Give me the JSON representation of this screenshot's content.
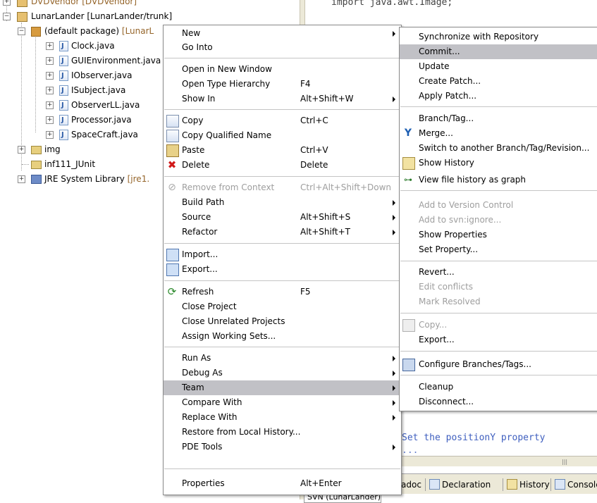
{
  "editor": {
    "code_top": "import java.awt.Image;",
    "comment_line": "Set the positionY property",
    "comment_line2": "...",
    "svn_tab": "SVN (LunarLander)"
  },
  "tree": {
    "top_row": "DVDVendor [DVDVendor]",
    "project": "LunarLander [LunarLander/trunk]",
    "package_label": "(default package)",
    "package_decor": "[LunarL",
    "files": [
      "Clock.java",
      "GUIEnvironment.java",
      "IObserver.java",
      "ISubject.java",
      "ObserverLL.java",
      "Processor.java",
      "SpaceCraft.java"
    ],
    "img": "img",
    "junit": "inf111_JUnit",
    "jre_label": "JRE System Library",
    "jre_decor": "[jre1."
  },
  "context_menu": {
    "items": [
      {
        "label": "New",
        "accel": "",
        "submenu": true
      },
      {
        "label": "Go Into",
        "accel": ""
      },
      {
        "label": "Open in New Window",
        "accel": ""
      },
      {
        "label": "Open Type Hierarchy",
        "accel": "F4"
      },
      {
        "label": "Show In",
        "accel": "Alt+Shift+W",
        "submenu": true
      },
      {
        "label": "Copy",
        "accel": "Ctrl+C",
        "icon": "copy-icon"
      },
      {
        "label": "Copy Qualified Name",
        "accel": "",
        "icon": "copy-icon"
      },
      {
        "label": "Paste",
        "accel": "Ctrl+V",
        "icon": "paste-icon"
      },
      {
        "label": "Delete",
        "accel": "Delete",
        "icon": "delete-icon"
      },
      {
        "label": "Remove from Context",
        "accel": "Ctrl+Alt+Shift+Down",
        "icon": "remove-icon",
        "disabled": true
      },
      {
        "label": "Build Path",
        "accel": "",
        "submenu": true
      },
      {
        "label": "Source",
        "accel": "Alt+Shift+S",
        "submenu": true
      },
      {
        "label": "Refactor",
        "accel": "Alt+Shift+T",
        "submenu": true
      },
      {
        "label": "Import...",
        "accel": "",
        "icon": "import-icon"
      },
      {
        "label": "Export...",
        "accel": "",
        "icon": "export-icon"
      },
      {
        "label": "Refresh",
        "accel": "F5",
        "icon": "refresh-icon"
      },
      {
        "label": "Close Project",
        "accel": ""
      },
      {
        "label": "Close Unrelated Projects",
        "accel": ""
      },
      {
        "label": "Assign Working Sets...",
        "accel": ""
      },
      {
        "label": "Run As",
        "accel": "",
        "submenu": true
      },
      {
        "label": "Debug As",
        "accel": "",
        "submenu": true
      },
      {
        "label": "Team",
        "accel": "",
        "submenu": true,
        "highlighted": true
      },
      {
        "label": "Compare With",
        "accel": "",
        "submenu": true
      },
      {
        "label": "Replace With",
        "accel": "",
        "submenu": true
      },
      {
        "label": "Restore from Local History...",
        "accel": ""
      },
      {
        "label": "PDE Tools",
        "accel": "",
        "submenu": true
      },
      {
        "label": "Properties",
        "accel": "Alt+Enter"
      }
    ]
  },
  "team_menu": {
    "items": [
      {
        "label": "Synchronize with Repository"
      },
      {
        "label": "Commit...",
        "highlighted": true
      },
      {
        "label": "Update"
      },
      {
        "label": "Create Patch..."
      },
      {
        "label": "Apply Patch..."
      },
      {
        "label": "Branch/Tag..."
      },
      {
        "label": "Merge...",
        "icon": "merge-icon"
      },
      {
        "label": "Switch to another Branch/Tag/Revision..."
      },
      {
        "label": "Show History",
        "icon": "history-icon"
      },
      {
        "label": "View file history as graph",
        "icon": "graph-icon"
      },
      {
        "label": "Add to Version Control",
        "disabled": true
      },
      {
        "label": "Add to svn:ignore...",
        "disabled": true
      },
      {
        "label": "Show Properties"
      },
      {
        "label": "Set Property..."
      },
      {
        "label": "Revert..."
      },
      {
        "label": "Edit conflicts",
        "disabled": true
      },
      {
        "label": "Mark Resolved",
        "disabled": true
      },
      {
        "label": "Copy...",
        "icon": "copy-icon",
        "disabled": true
      },
      {
        "label": "Export..."
      },
      {
        "label": "Configure Branches/Tags...",
        "icon": "config-icon"
      },
      {
        "label": "Cleanup"
      },
      {
        "label": "Disconnect..."
      }
    ]
  },
  "bottom_tabs": {
    "javadoc": "adoc",
    "declaration": "Declaration",
    "history": "History",
    "console": "Console"
  }
}
